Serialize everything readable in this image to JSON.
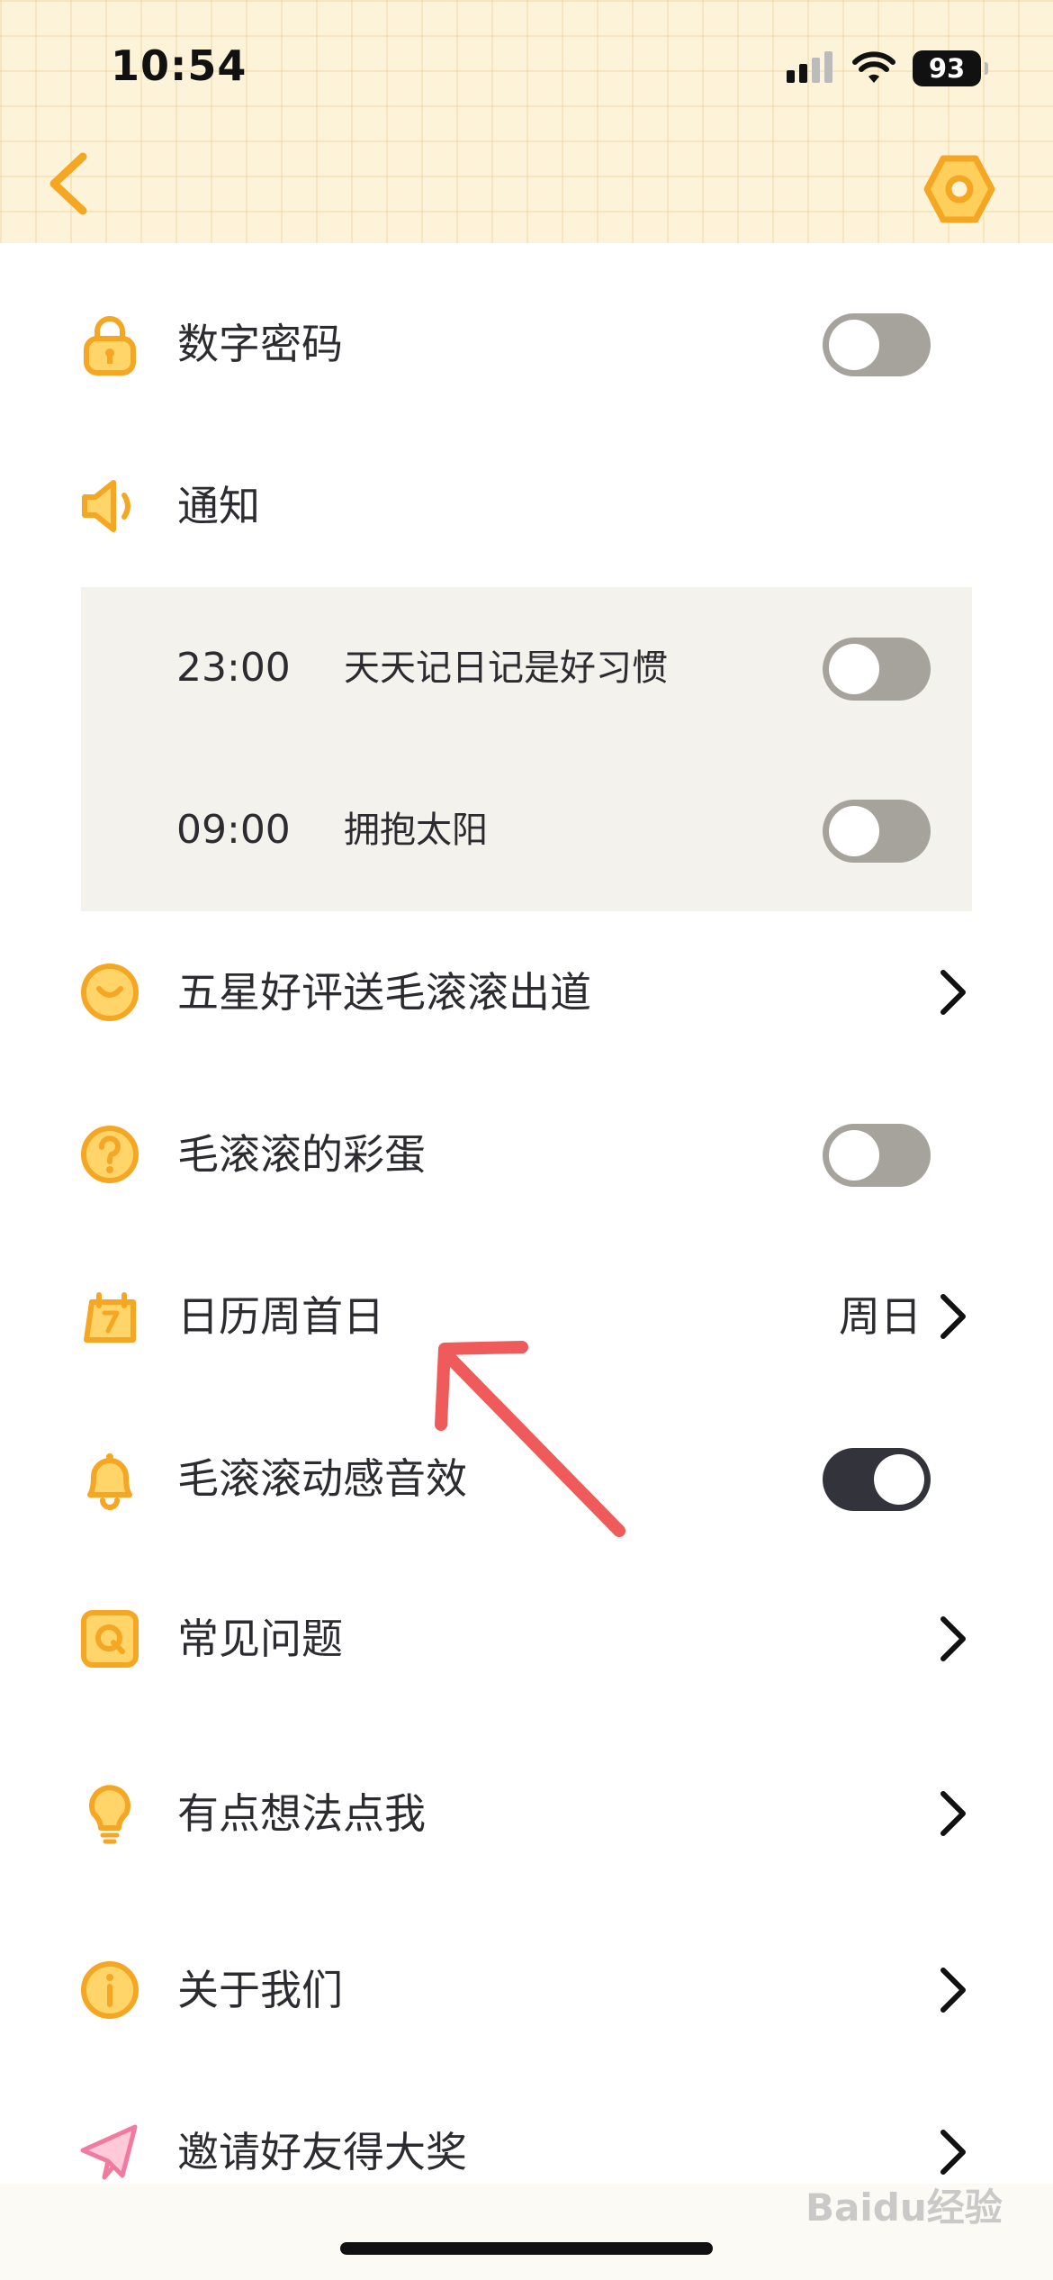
{
  "status_bar": {
    "time": "10:54",
    "battery": "93"
  },
  "settings": {
    "passcode": {
      "label": "数字密码",
      "toggle_on": false
    },
    "notify": {
      "label": "通知"
    },
    "reminders": [
      {
        "time": "23:00",
        "text": "天天记日记是好习惯",
        "toggle_on": false
      },
      {
        "time": "09:00",
        "text": "拥抱太阳",
        "toggle_on": false
      }
    ],
    "rate": {
      "label": "五星好评送毛滚滚出道"
    },
    "easter_egg": {
      "label": "毛滚滚的彩蛋",
      "toggle_on": false
    },
    "week_start": {
      "label": "日历周首日",
      "value": "周日"
    },
    "sound": {
      "label": "毛滚滚动感音效",
      "toggle_on": true
    },
    "faq": {
      "label": "常见问题"
    },
    "feedback": {
      "label": "有点想法点我"
    },
    "about": {
      "label": "关于我们"
    },
    "invite": {
      "label": "邀请好友得大奖"
    }
  },
  "watermark": "Baidu经验",
  "colors": {
    "accent": "#f5a623",
    "header_bg": "#fdf3d8",
    "toggle_off": "#a6a39d",
    "toggle_on": "#33333c",
    "annotation_arrow": "#ef5b5b"
  }
}
